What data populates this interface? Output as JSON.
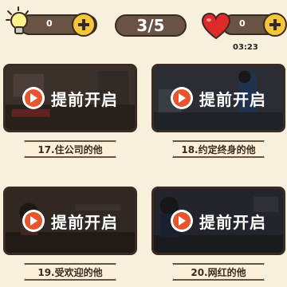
{
  "hints": {
    "count": "0"
  },
  "level": {
    "text": "3/5"
  },
  "lives": {
    "count": "0",
    "timer": "03:23"
  },
  "cards": [
    {
      "cta": "提前开启",
      "title": "17.住公司的他"
    },
    {
      "cta": "提前开启",
      "title": "18.约定终身的他"
    },
    {
      "cta": "提前开启",
      "title": "19.受欢迎的他"
    },
    {
      "cta": "提前开启",
      "title": "20.网红的他"
    }
  ],
  "colors": {
    "accent": "#e8542b",
    "coin": "#f5c63a",
    "pill": "#6a5245",
    "background": "#f7f0dc"
  },
  "icons": {
    "hint": "lightbulb-icon",
    "plus": "plus-icon",
    "lives": "heart-icon",
    "play": "play-icon"
  }
}
